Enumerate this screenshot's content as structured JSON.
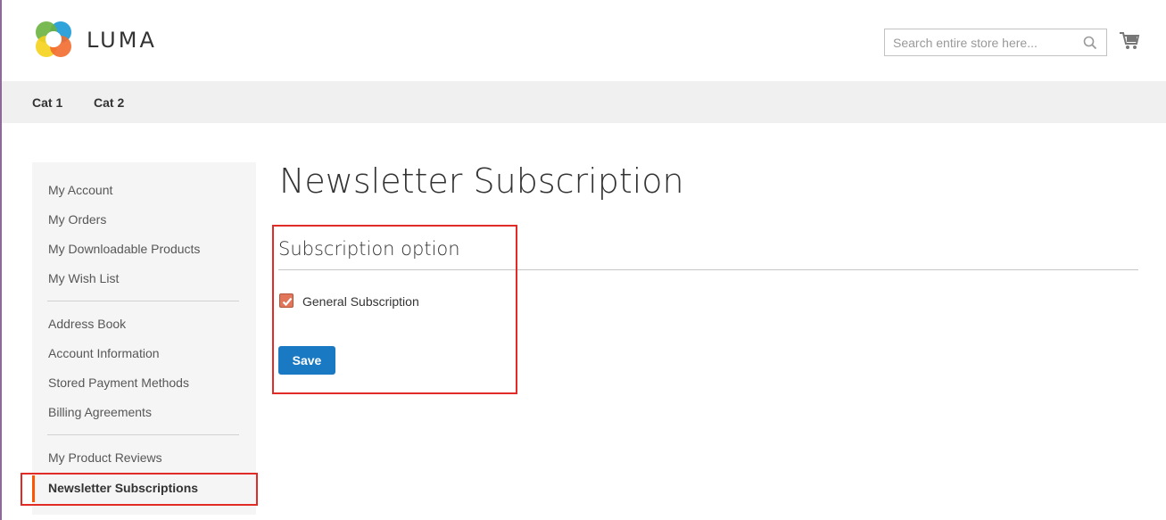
{
  "brand": {
    "name": "LUMA"
  },
  "search": {
    "placeholder": "Search entire store here..."
  },
  "nav": {
    "items": [
      {
        "label": "Cat 1"
      },
      {
        "label": "Cat 2"
      }
    ]
  },
  "sidebar": {
    "group1": [
      {
        "label": "My Account"
      },
      {
        "label": "My Orders"
      },
      {
        "label": "My Downloadable Products"
      },
      {
        "label": "My Wish List"
      }
    ],
    "group2": [
      {
        "label": "Address Book"
      },
      {
        "label": "Account Information"
      },
      {
        "label": "Stored Payment Methods"
      },
      {
        "label": "Billing Agreements"
      }
    ],
    "group3": [
      {
        "label": "My Product Reviews"
      }
    ],
    "active": {
      "label": "Newsletter Subscriptions"
    }
  },
  "main": {
    "title": "Newsletter Subscription",
    "section_title": "Subscription option",
    "checkbox": {
      "label": "General Subscription",
      "checked": true
    },
    "save_label": "Save"
  },
  "colors": {
    "accent": "#1979c3",
    "active_bar": "#ff5501",
    "highlight": "#e02b27",
    "checkbox": "#e2765a"
  },
  "icons": {
    "search": "search-icon",
    "cart": "cart-icon",
    "check": "check-icon",
    "logo": "luma-logo-icon"
  }
}
